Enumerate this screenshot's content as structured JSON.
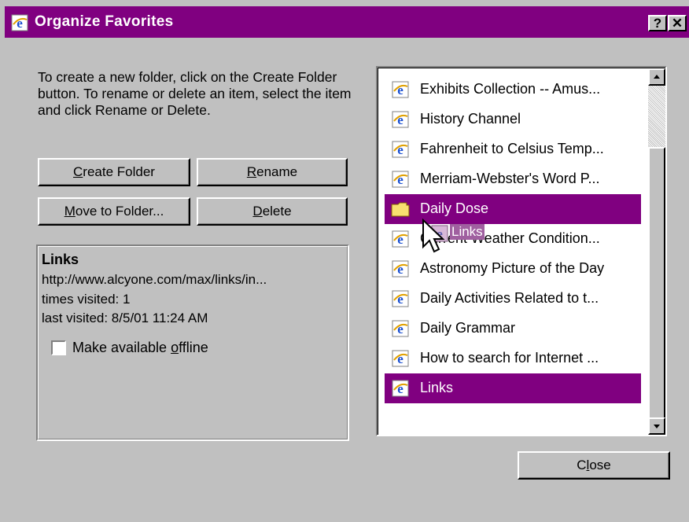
{
  "window": {
    "title": "Organize Favorites",
    "help_label": "?",
    "close_label": "✕",
    "title_bar_color": "#800080"
  },
  "instructions": "To create a new folder, click on the Create Folder button. To rename or delete an item, select the item and click Rename or Delete.",
  "buttons": {
    "create_folder": {
      "mnemonic": "C",
      "rest": "reate Folder"
    },
    "rename": {
      "mnemonic": "R",
      "rest": "ename"
    },
    "move_to_folder": {
      "mnemonic": "M",
      "rest": "ove to Folder..."
    },
    "delete": {
      "mnemonic": "D",
      "rest": "elete"
    },
    "close": {
      "pre": "C",
      "mnemonic": "l",
      "rest": "ose"
    }
  },
  "details": {
    "name": "Links",
    "url": "http://www.alcyone.com/max/links/in...",
    "times_visited": "times visited: 1",
    "last_visited": "last visited: 8/5/01 11:24 AM",
    "offline": {
      "pre": "Make available ",
      "mnemonic": "o",
      "rest": "ffline",
      "checked": false
    }
  },
  "favorites": [
    {
      "label": "Exhibits Collection -- Amus...",
      "icon": "ie-page-icon",
      "selected": false
    },
    {
      "label": "History Channel",
      "icon": "ie-page-icon",
      "selected": false
    },
    {
      "label": "Fahrenheit to Celsius Temp...",
      "icon": "ie-page-icon",
      "selected": false
    },
    {
      "label": "Merriam-Webster's Word P...",
      "icon": "ie-page-icon",
      "selected": false
    },
    {
      "label": "Daily Dose",
      "icon": "folder-icon",
      "selected": true
    },
    {
      "label": "Current Weather Condition...",
      "icon": "ie-page-icon",
      "selected": false
    },
    {
      "label": "Astronomy Picture of the Day",
      "icon": "ie-page-icon",
      "selected": false
    },
    {
      "label": "Daily Activities Related to t...",
      "icon": "ie-page-icon",
      "selected": false
    },
    {
      "label": "Daily Grammar",
      "icon": "ie-page-icon",
      "selected": false
    },
    {
      "label": "How to search for Internet ...",
      "icon": "ie-page-icon",
      "selected": false
    },
    {
      "label": "Links",
      "icon": "ie-page-icon",
      "selected": true
    }
  ],
  "drag_ghost_label": "Links",
  "colors": {
    "selection": "#800080",
    "face": "#c0c0c0"
  }
}
